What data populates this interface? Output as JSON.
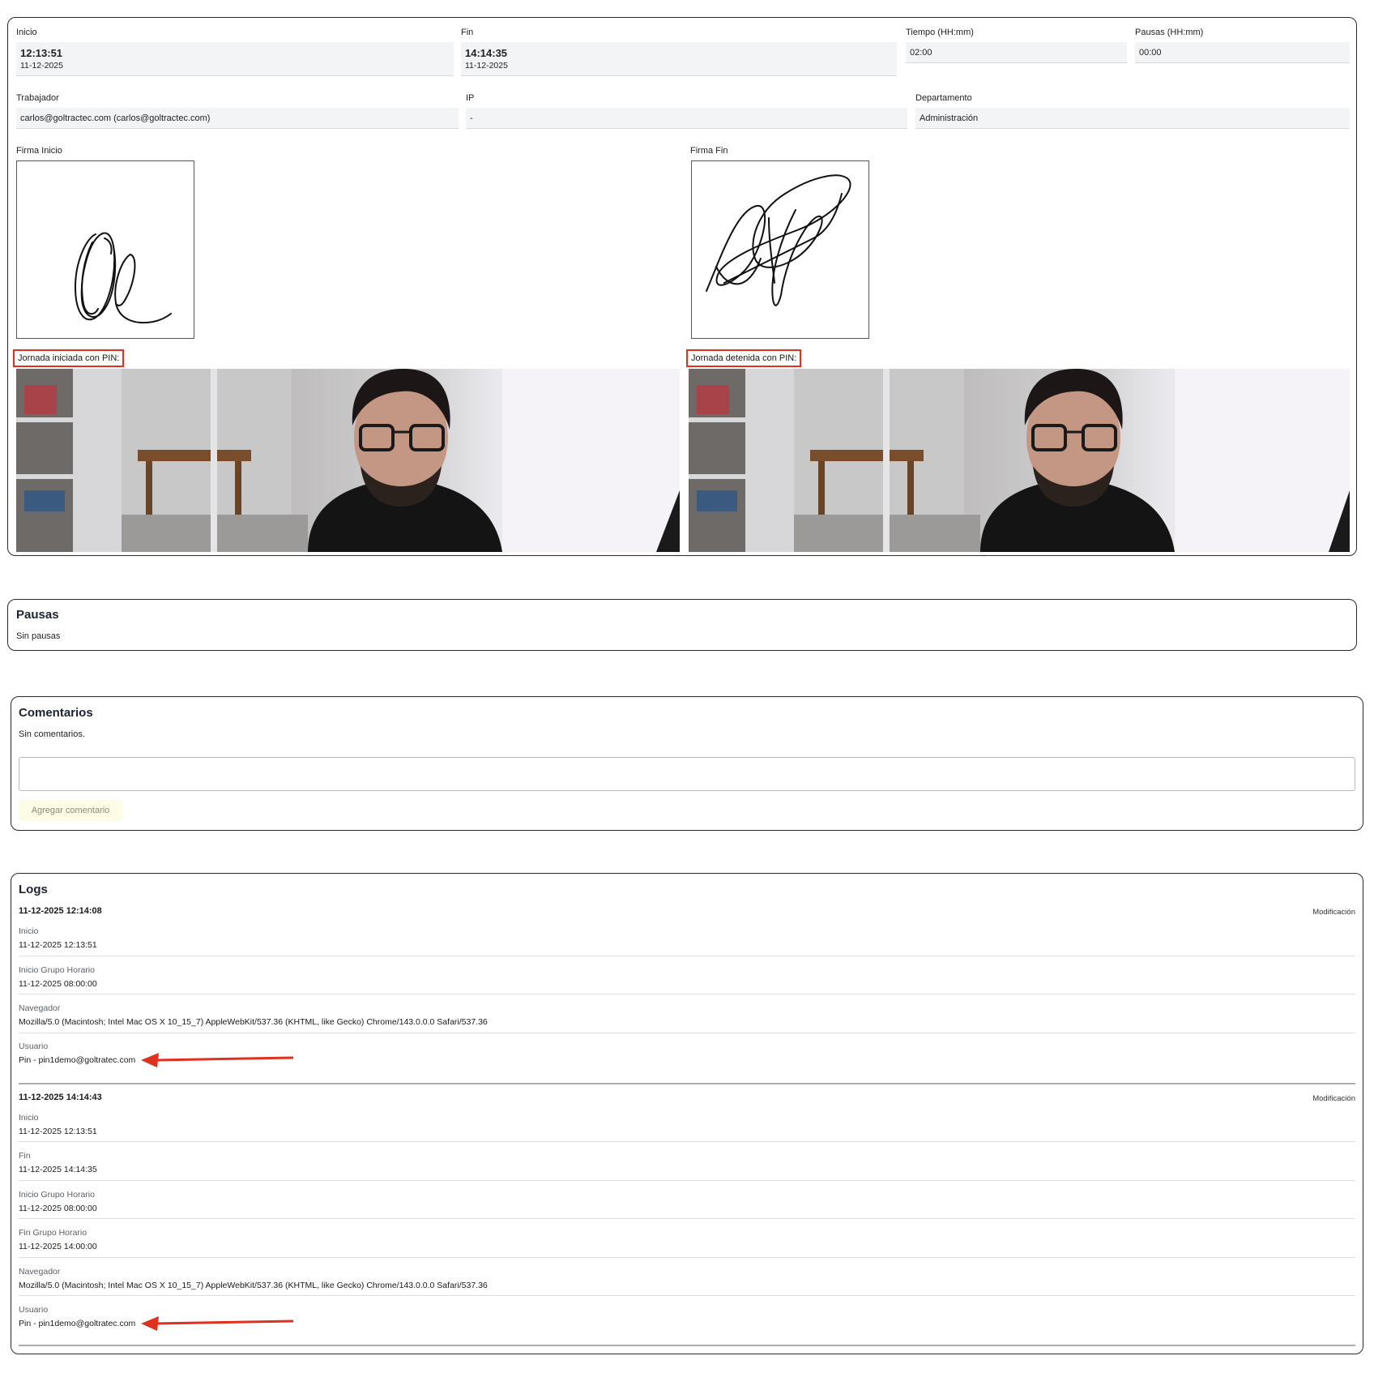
{
  "record": {
    "inicio": {
      "label": "Inicio",
      "time": "12:13:51",
      "date": "11-12-2025"
    },
    "fin": {
      "label": "Fin",
      "time": "14:14:35",
      "date": "11-12-2025"
    },
    "tiempo": {
      "label": "Tiempo (HH:mm)",
      "value": "02:00"
    },
    "pausas": {
      "label": "Pausas (HH:mm)",
      "value": "00:00"
    },
    "trabajador": {
      "label": "Trabajador",
      "value": "carlos@goltractec.com (carlos@goltractec.com)"
    },
    "ip": {
      "label": "IP",
      "value": "-"
    },
    "departamento": {
      "label": "Departamento",
      "value": "Administración"
    },
    "firma_inicio_label": "Firma Inicio",
    "firma_fin_label": "Firma Fin",
    "pin_start_label": "Jornada iniciada con PIN:",
    "pin_stop_label": "Jornada detenida con PIN:"
  },
  "pausas_section": {
    "title": "Pausas",
    "empty_text": "Sin pausas"
  },
  "comentarios_section": {
    "title": "Comentarios",
    "empty_text": "Sin comentarios.",
    "input_value": "",
    "button_label": "Agregar comentario"
  },
  "logs_section": {
    "title": "Logs",
    "entries": [
      {
        "timestamp": "11-12-2025 12:14:08",
        "type": "Modificación",
        "fields": [
          {
            "key": "Inicio",
            "value": "11-12-2025 12:13:51"
          },
          {
            "key": "Inicio Grupo Horario",
            "value": "11-12-2025 08:00:00"
          },
          {
            "key": "Navegador",
            "value": "Mozilla/5.0 (Macintosh; Intel Mac OS X 10_15_7) AppleWebKit/537.36 (KHTML, like Gecko) Chrome/143.0.0.0 Safari/537.36"
          },
          {
            "key": "Usuario",
            "value": "Pin - pin1demo@goltratec.com"
          }
        ]
      },
      {
        "timestamp": "11-12-2025 14:14:43",
        "type": "Modificación",
        "fields": [
          {
            "key": "Inicio",
            "value": "11-12-2025 12:13:51"
          },
          {
            "key": "Fin",
            "value": "11-12-2025 14:14:35"
          },
          {
            "key": "Inicio Grupo Horario",
            "value": "11-12-2025 08:00:00"
          },
          {
            "key": "Fin Grupo Horario",
            "value": "11-12-2025 14:00:00"
          },
          {
            "key": "Navegador",
            "value": "Mozilla/5.0 (Macintosh; Intel Mac OS X 10_15_7) AppleWebKit/537.36 (KHTML, like Gecko) Chrome/143.0.0.0 Safari/537.36"
          },
          {
            "key": "Usuario",
            "value": "Pin - pin1demo@goltratec.com"
          }
        ]
      }
    ]
  },
  "colors": {
    "annotation_red": "#e0301e",
    "button_bg": "#fdfce6"
  }
}
